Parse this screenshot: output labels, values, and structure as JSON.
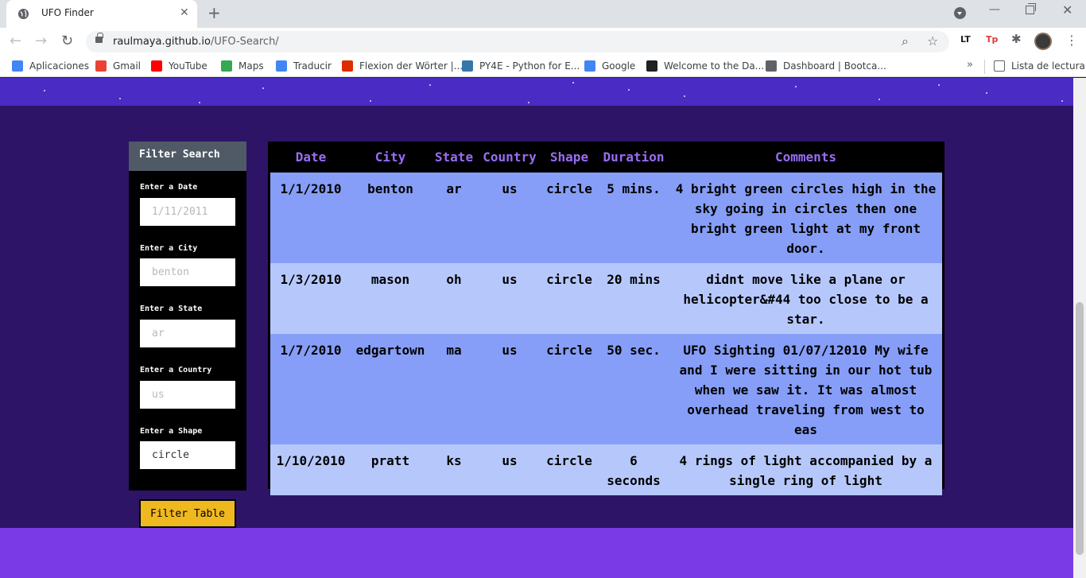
{
  "browser": {
    "tab_title": "UFO Finder",
    "url_host": "raulmaya.github.io",
    "url_path": "/UFO-Search/",
    "bookmarks": [
      {
        "label": "Aplicaciones",
        "icon": "apps-grid-icon",
        "color": "#4285f4"
      },
      {
        "label": "Gmail",
        "icon": "gmail-icon",
        "color": "#ea4335"
      },
      {
        "label": "YouTube",
        "icon": "youtube-icon",
        "color": "#ff0000"
      },
      {
        "label": "Maps",
        "icon": "maps-pin-icon",
        "color": "#34a853"
      },
      {
        "label": "Traducir",
        "icon": "translate-icon",
        "color": "#4285f4"
      },
      {
        "label": "Flexion der Wörter |...",
        "icon": "flag-icon",
        "color": "#dd2c00"
      },
      {
        "label": "PY4E - Python for E...",
        "icon": "python-icon",
        "color": "#3776ab"
      },
      {
        "label": "Google",
        "icon": "google-icon",
        "color": "#4285f4"
      },
      {
        "label": "Welcome to the Da...",
        "icon": "book-icon",
        "color": "#202124"
      },
      {
        "label": "Dashboard | Bootca...",
        "icon": "globe-icon",
        "color": "#5f6368"
      }
    ],
    "reading_list": "Lista de lectura"
  },
  "filters": {
    "header": "Filter Search",
    "fields": [
      {
        "label": "Enter a Date",
        "placeholder": "1/11/2011",
        "value": ""
      },
      {
        "label": "Enter a City",
        "placeholder": "benton",
        "value": ""
      },
      {
        "label": "Enter a State",
        "placeholder": "ar",
        "value": ""
      },
      {
        "label": "Enter a Country",
        "placeholder": "us",
        "value": ""
      },
      {
        "label": "Enter a Shape",
        "placeholder": "",
        "value": "circle"
      }
    ],
    "button_label": "Filter Table"
  },
  "table": {
    "headers": [
      "Date",
      "City",
      "State",
      "Country",
      "Shape",
      "Duration",
      "Comments"
    ],
    "rows": [
      [
        "1/1/2010",
        "benton",
        "ar",
        "us",
        "circle",
        "5 mins.",
        "4 bright green circles high in the sky going in circles then one bright green light at my front door."
      ],
      [
        "1/3/2010",
        "mason",
        "oh",
        "us",
        "circle",
        "20 mins",
        "didnt move like a plane or helicopter&#44 too close to be a star."
      ],
      [
        "1/7/2010",
        "edgartown",
        "ma",
        "us",
        "circle",
        "50 sec.",
        "UFO Sighting 01/07/12010 My wife and I were sitting in our hot tub when we saw it. It was almost overhead traveling from west to eas"
      ],
      [
        "1/10/2010",
        "pratt",
        "ks",
        "us",
        "circle",
        "6 seconds",
        "4 rings of light accompanied by a single ring of light"
      ]
    ]
  },
  "colors": {
    "hero": "#4a2bc4",
    "background": "#2e1466",
    "footer": "#7a3ae6",
    "header_text": "#9a6cf6",
    "row_odd": "#869ef7",
    "row_even": "#b6c8fb",
    "button": "#f0b81f"
  }
}
